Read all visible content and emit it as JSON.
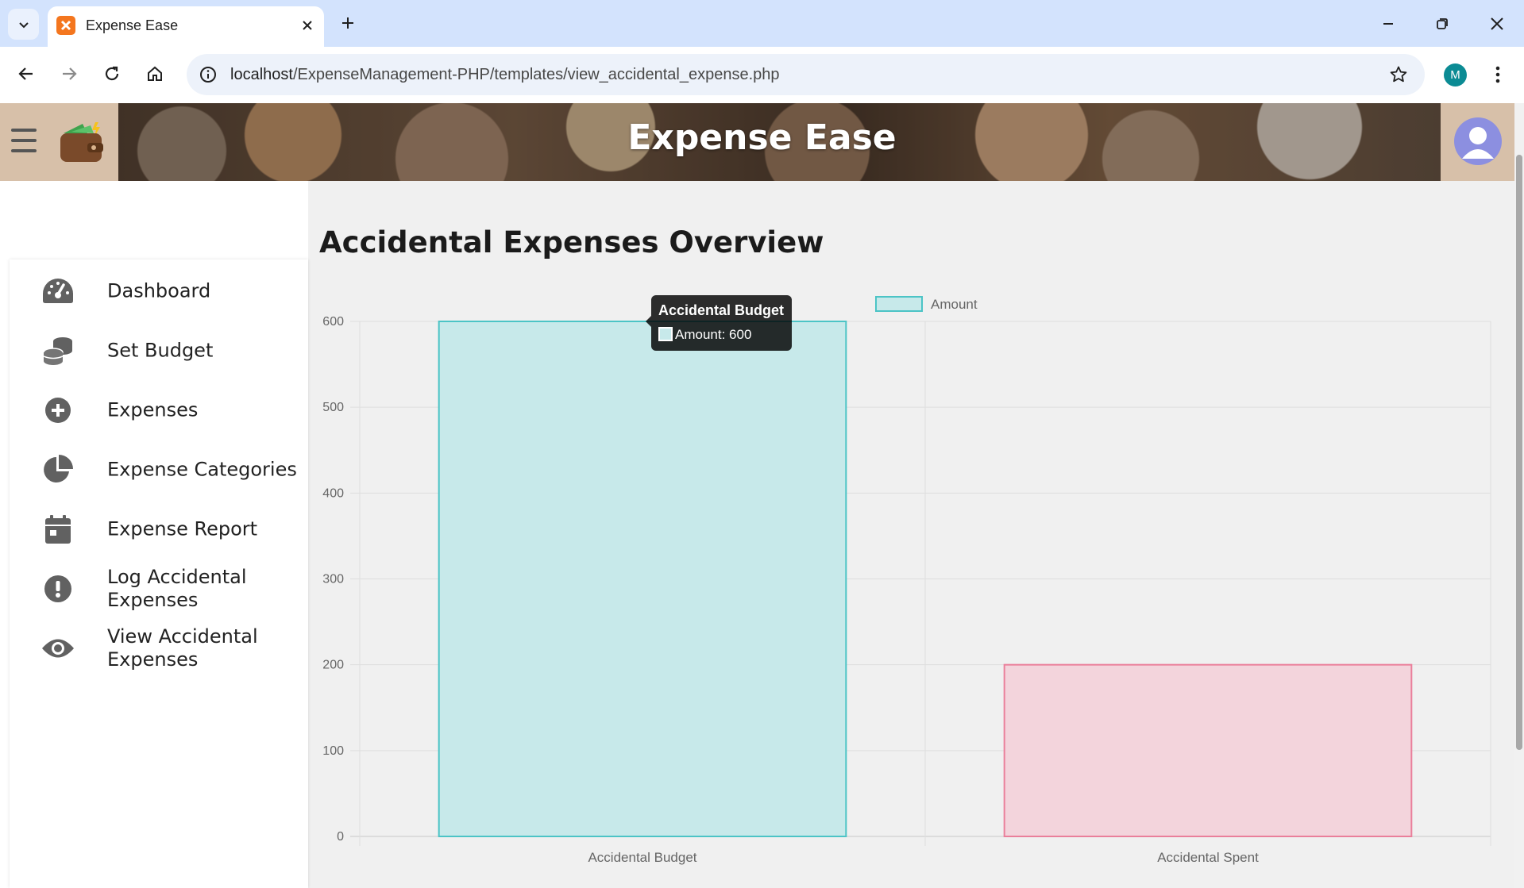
{
  "browser": {
    "tab_title": "Expense Ease",
    "url_host": "localhost",
    "url_path": "/ExpenseManagement-PHP/templates/view_accidental_expense.php",
    "profile_initial": "M"
  },
  "app": {
    "title": "Expense Ease"
  },
  "sidebar": {
    "items": [
      {
        "label": "Dashboard",
        "icon": "tachometer-icon"
      },
      {
        "label": "Set Budget",
        "icon": "coins-icon"
      },
      {
        "label": "Expenses",
        "icon": "plus-circle-icon"
      },
      {
        "label": "Expense Categories",
        "icon": "pie-chart-icon"
      },
      {
        "label": "Expense Report",
        "icon": "calendar-icon"
      },
      {
        "label": "Log Accidental Expenses",
        "icon": "exclamation-circle-icon"
      },
      {
        "label": "View Accidental Expenses",
        "icon": "eye-icon"
      }
    ]
  },
  "page": {
    "title": "Accidental Expenses Overview"
  },
  "tooltip": {
    "title": "Accidental Budget",
    "body": "Amount: 600"
  },
  "chart_data": {
    "type": "bar",
    "categories": [
      "Accidental Budget",
      "Accidental Spent"
    ],
    "series": [
      {
        "name": "Amount",
        "values": [
          600,
          200
        ]
      }
    ],
    "bar_fills": [
      "#c7e9ea",
      "#f3d4dc"
    ],
    "bar_strokes": [
      "#4cc4c6",
      "#ea7f9b"
    ],
    "legend_fill": "#c7e9ea",
    "legend_stroke": "#4cc4c6",
    "yticks": [
      0,
      100,
      200,
      300,
      400,
      500,
      600
    ],
    "ylim": [
      0,
      600
    ],
    "grid": true,
    "legend_position": "top"
  }
}
